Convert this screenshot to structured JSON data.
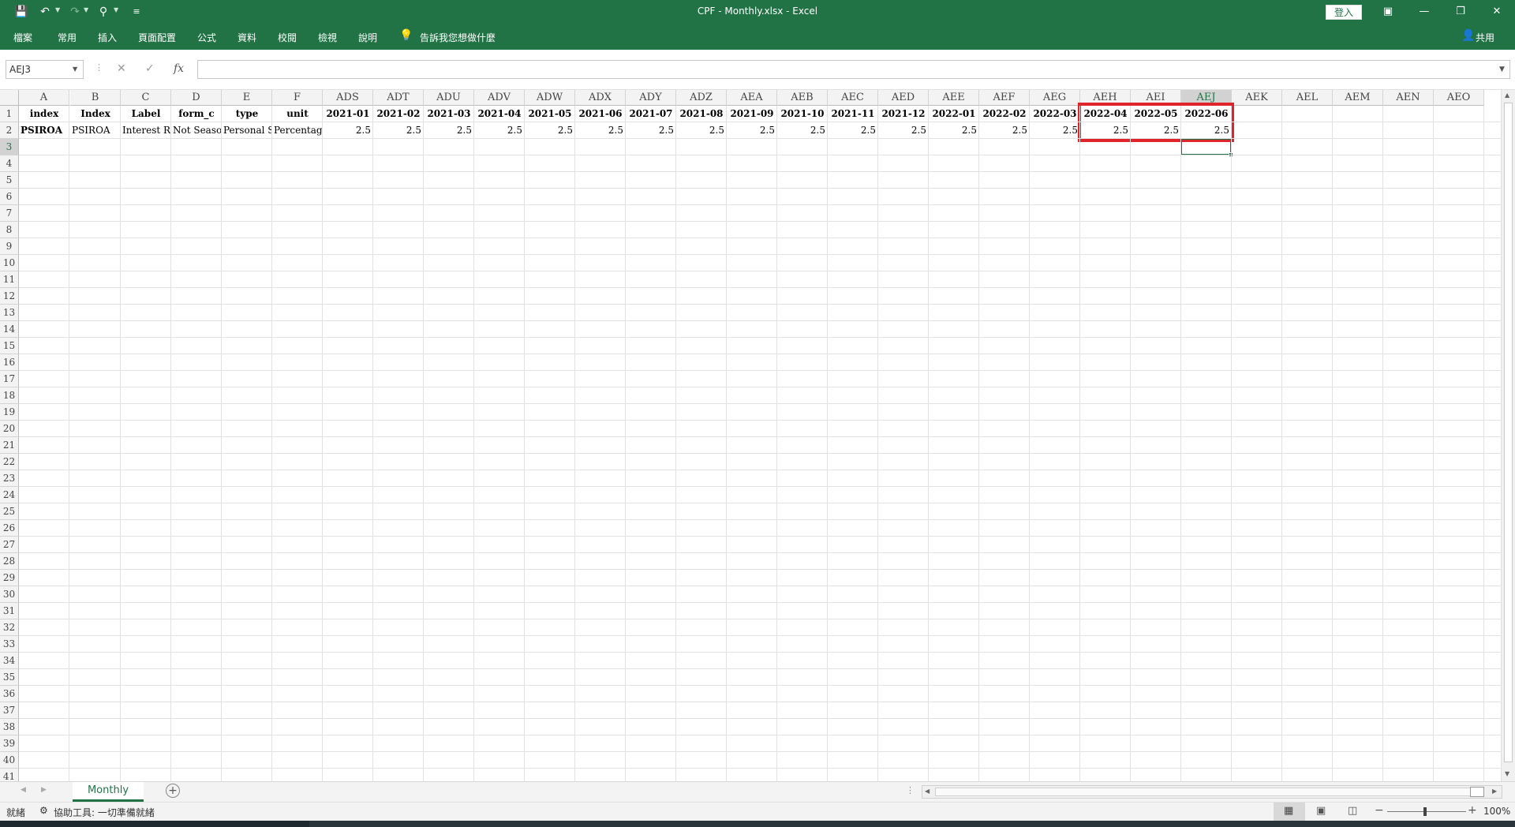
{
  "window": {
    "title": "CPF - Monthly.xlsx  -  Excel",
    "signin_label": "登入"
  },
  "ribbon": {
    "tabs": [
      "檔案",
      "常用",
      "插入",
      "頁面配置",
      "公式",
      "資料",
      "校閱",
      "檢視",
      "說明"
    ],
    "tell_me": "告訴我您想做什麼",
    "share": "共用"
  },
  "formula_bar": {
    "name_box": "AEJ3",
    "fx_label": "fx",
    "value": ""
  },
  "columns": [
    "A",
    "B",
    "C",
    "D",
    "E",
    "F",
    "ADS",
    "ADT",
    "ADU",
    "ADV",
    "ADW",
    "ADX",
    "ADY",
    "ADZ",
    "AEA",
    "AEB",
    "AEC",
    "AED",
    "AEE",
    "AEF",
    "AEG",
    "AEH",
    "AEI",
    "AEJ",
    "AEK",
    "AEL",
    "AEM",
    "AEN",
    "AEO"
  ],
  "selected_column": "AEJ",
  "row_count": 41,
  "selected_row": 3,
  "rows": [
    [
      "index",
      "Index",
      "Label",
      "form_c",
      "type",
      "unit",
      "2021-01",
      "2021-02",
      "2021-03",
      "2021-04",
      "2021-05",
      "2021-06",
      "2021-07",
      "2021-08",
      "2021-09",
      "2021-10",
      "2021-11",
      "2021-12",
      "2022-01",
      "2022-02",
      "2022-03",
      "2022-04",
      "2022-05",
      "2022-06"
    ],
    [
      "PSIROA",
      "PSIROA",
      "Interest Ra",
      "Not Season",
      "Personal S:",
      "Percentage",
      "2.5",
      "2.5",
      "2.5",
      "2.5",
      "2.5",
      "2.5",
      "2.5",
      "2.5",
      "2.5",
      "2.5",
      "2.5",
      "2.5",
      "2.5",
      "2.5",
      "2.5",
      "2.5",
      "2.5",
      "2.5"
    ]
  ],
  "sheets": [
    "Monthly"
  ],
  "status": {
    "ready": "就緒",
    "accessibility": "協助工具: 一切準備就緒",
    "zoom": "100%"
  }
}
